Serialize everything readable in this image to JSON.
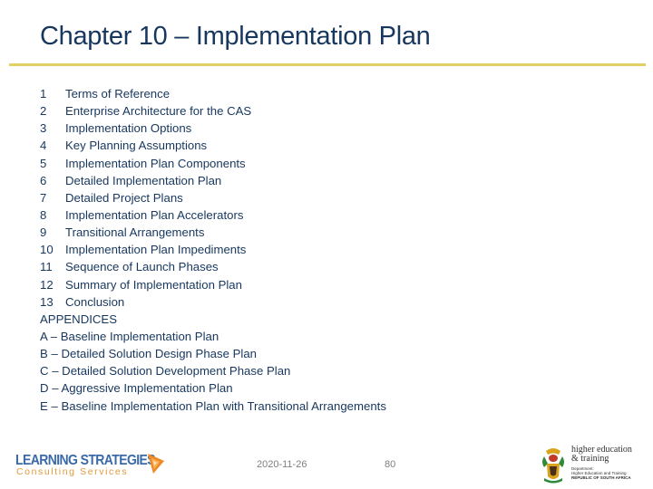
{
  "slide": {
    "title": "Chapter 10 – Implementation Plan",
    "colors": {
      "title": "#17375e",
      "rule": "#e3cf64",
      "body_text": "#17375e",
      "footer_text": "#808080"
    }
  },
  "toc": {
    "items": [
      {
        "number": "1",
        "label": "Terms of Reference"
      },
      {
        "number": "2",
        "label": "Enterprise Architecture for the CAS"
      },
      {
        "number": "3",
        "label": "Implementation Options"
      },
      {
        "number": "4",
        "label": "Key Planning Assumptions"
      },
      {
        "number": "5",
        "label": "Implementation Plan Components"
      },
      {
        "number": "6",
        "label": "Detailed Implementation Plan"
      },
      {
        "number": "7",
        "label": "Detailed Project Plans"
      },
      {
        "number": "8",
        "label": "Implementation Plan Accelerators"
      },
      {
        "number": "9",
        "label": "Transitional Arrangements"
      },
      {
        "number": "10",
        "label": "Implementation Plan Impediments"
      },
      {
        "number": "11",
        "label": "Sequence of Launch Phases"
      },
      {
        "number": "12",
        "label": "Summary of Implementation Plan"
      },
      {
        "number": "13",
        "label": "Conclusion"
      }
    ],
    "appendices_heading": "APPENDICES",
    "appendices": [
      "A – Baseline Implementation Plan",
      "B – Detailed Solution Design Phase Plan",
      "C – Detailed Solution Development Phase Plan",
      "D – Aggressive Implementation Plan",
      "E – Baseline Implementation Plan with Transitional Arrangements"
    ]
  },
  "footer": {
    "date": "2020-11-26",
    "page_number": "80",
    "left_logo": {
      "line1": "LEARNING STRATEGIES",
      "line2": "Consulting Services",
      "icon": "orange-triangle-play-icon",
      "colors": {
        "line1": "#3b6aa8",
        "line2": "#e39a3a",
        "icon": "#f08a24"
      }
    },
    "right_logo": {
      "icon": "south-africa-coat-of-arms-icon",
      "line1": "higher education",
      "line2": "& training",
      "line3": "Department:",
      "line4": "Higher Education and Training",
      "line5": "REPUBLIC OF SOUTH AFRICA"
    }
  }
}
